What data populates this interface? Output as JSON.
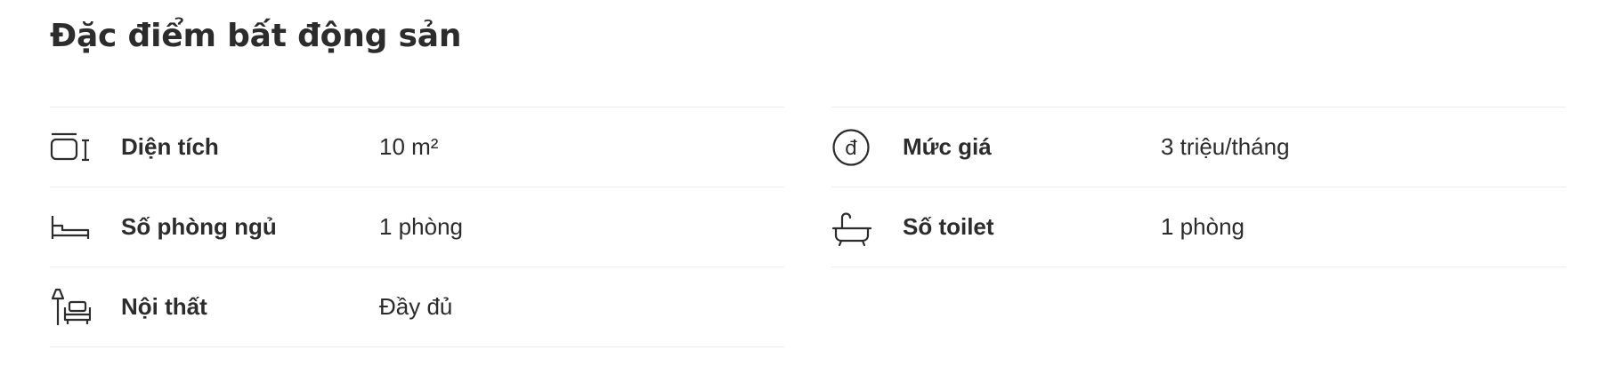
{
  "section": {
    "title": "Đặc điểm bất động sản"
  },
  "left_column": [
    {
      "icon": "area-icon",
      "label": "Diện tích",
      "value": "10 m²"
    },
    {
      "icon": "bed-icon",
      "label": "Số phòng ngủ",
      "value": "1 phòng"
    },
    {
      "icon": "furniture-icon",
      "label": "Nội thất",
      "value": "Đầy đủ"
    }
  ],
  "right_column": [
    {
      "icon": "price-icon",
      "label": "Mức giá",
      "value": "3 triệu/tháng"
    },
    {
      "icon": "bathtub-icon",
      "label": "Số toilet",
      "value": "1 phòng"
    }
  ],
  "price_icon_glyph": "đ",
  "colors": {
    "text": "#2c2c2c",
    "divider": "#ececec"
  }
}
